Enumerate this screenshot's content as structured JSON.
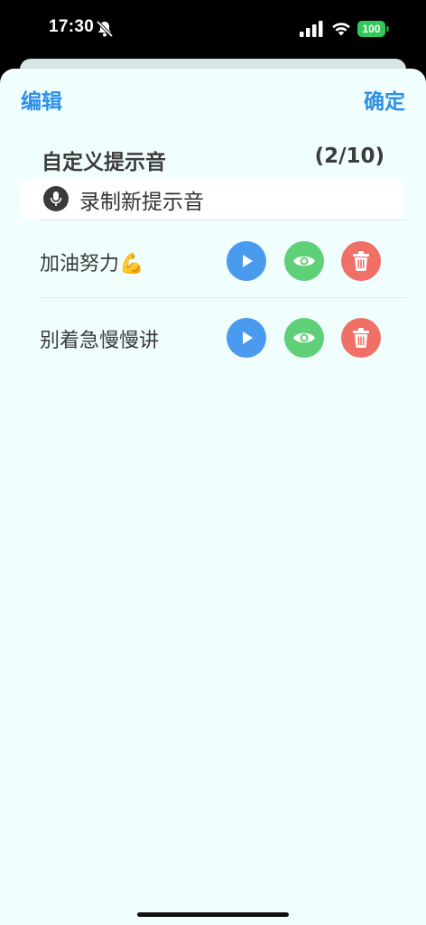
{
  "status": {
    "time": "17:30",
    "battery": "100"
  },
  "nav": {
    "edit_label": "编辑",
    "done_label": "确定"
  },
  "section": {
    "title": "自定义提示音",
    "count": "(2/10)"
  },
  "record": {
    "label": "录制新提示音",
    "icon": "mic-icon"
  },
  "items": [
    {
      "label": "加油努力💪"
    },
    {
      "label": "别着急慢慢讲"
    }
  ],
  "colors": {
    "accent": "#2f8fe6",
    "play": "#4a9af0",
    "view": "#5fcf78",
    "delete": "#f07068",
    "sheet": "#f0fffe"
  }
}
